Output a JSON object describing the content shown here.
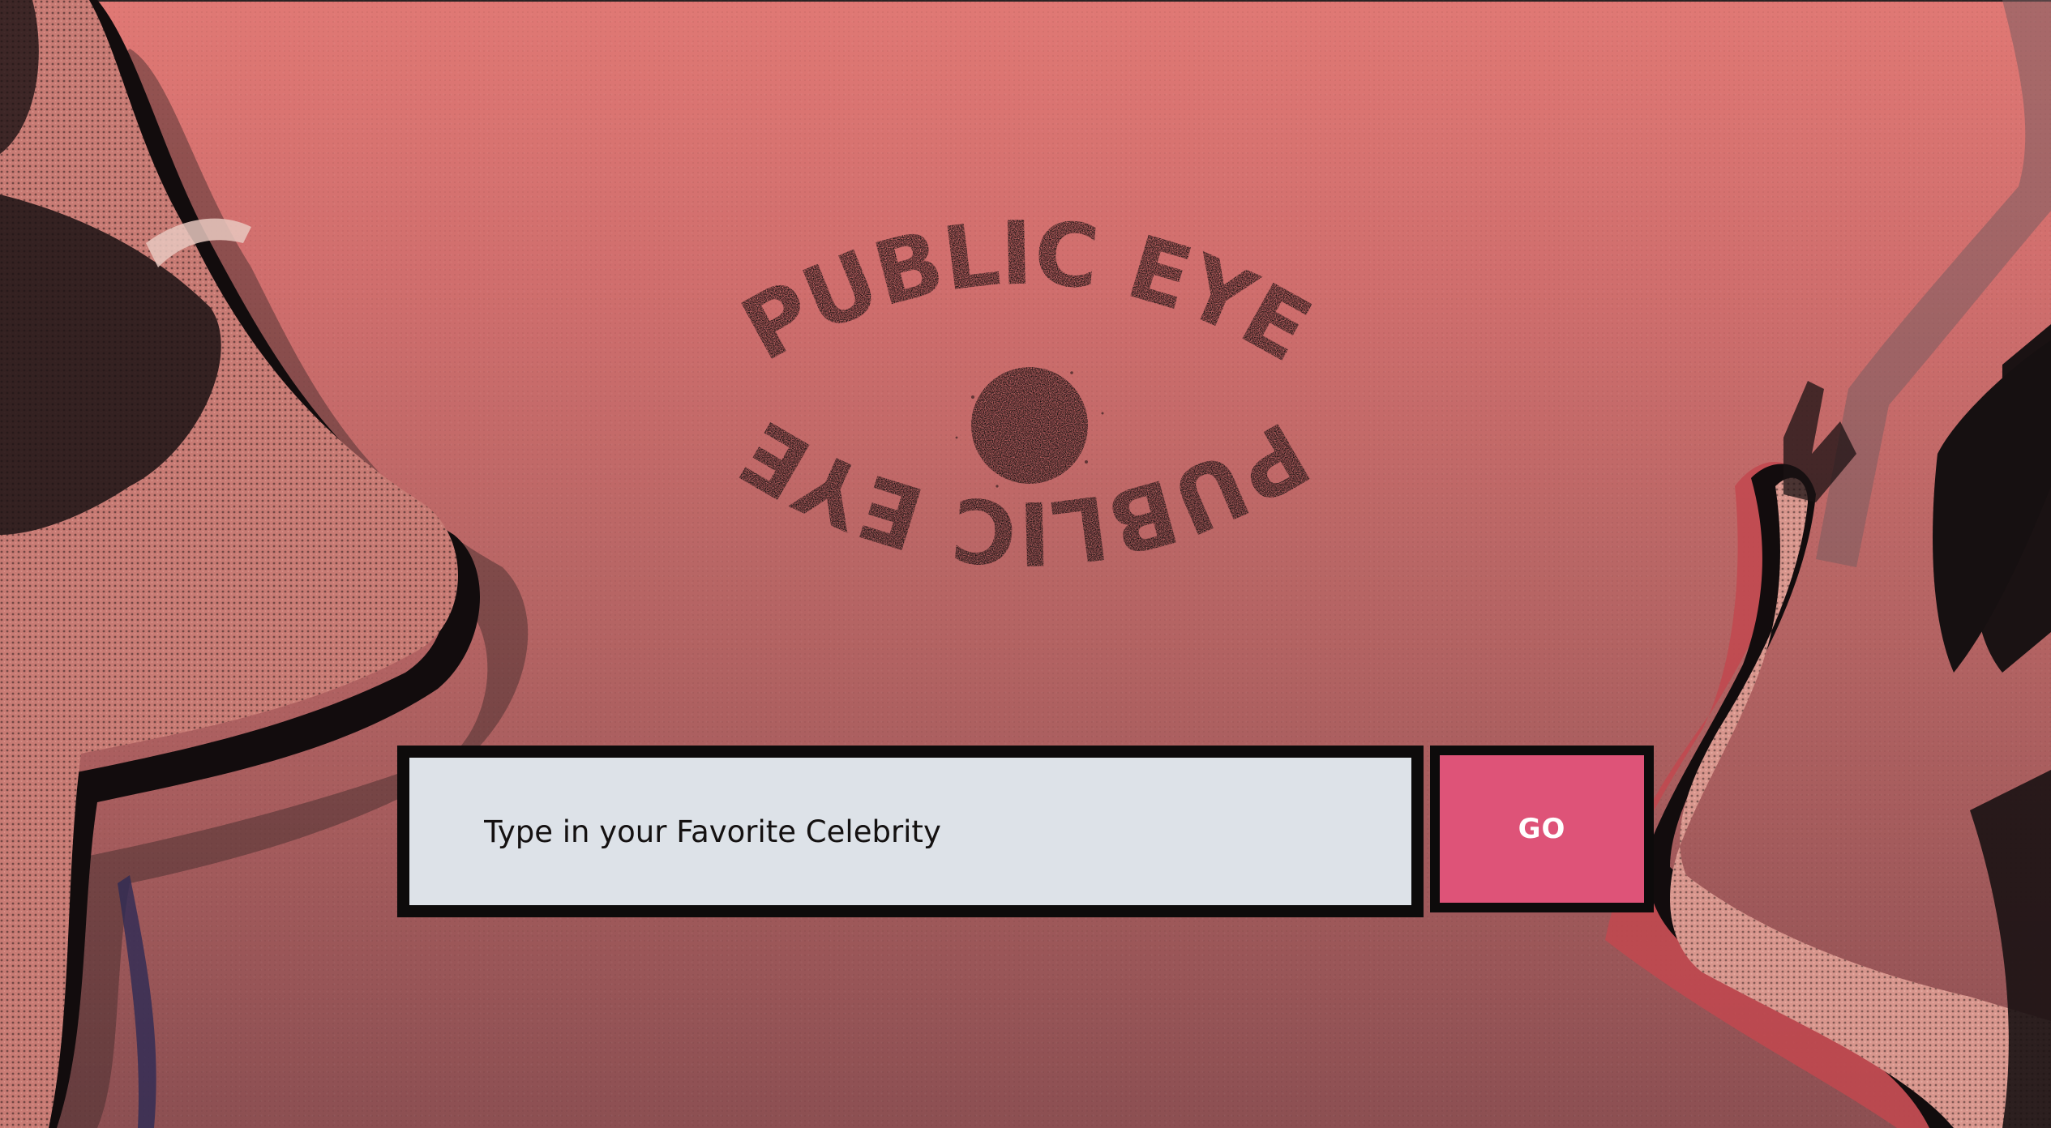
{
  "brand": {
    "logo_top_text": "PUBLIC EYE",
    "logo_bottom_text": "PUBLIC EYE"
  },
  "search": {
    "placeholder": "Type in your Favorite Celebrity",
    "value": ""
  },
  "go_button": {
    "label": "GO"
  },
  "colors": {
    "background_top": "#e07874",
    "background_bottom": "#8c4f52",
    "input_background": "#dde2e8",
    "button_background": "#de5378",
    "border": "#0d0b0b"
  },
  "icons": {
    "logo": "eye-logo-icon",
    "left_photo": "celebrity-photo-left",
    "right_photo": "celebrity-photo-right"
  }
}
